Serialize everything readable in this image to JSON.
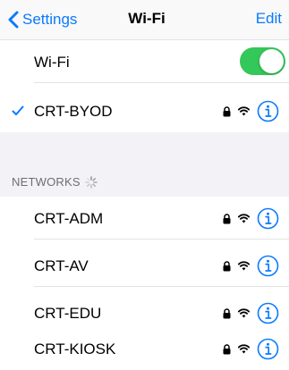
{
  "navbar": {
    "back_label": "Settings",
    "title": "Wi-Fi",
    "edit_label": "Edit"
  },
  "wifi_toggle": {
    "label": "Wi-Fi",
    "on": true
  },
  "connected": {
    "name": "CRT-BYOD",
    "secured": true
  },
  "networks_header": "NETWORKS",
  "networks": [
    {
      "name": "CRT-ADM",
      "secured": true
    },
    {
      "name": "CRT-AV",
      "secured": true
    },
    {
      "name": "CRT-EDU",
      "secured": true
    },
    {
      "name": "CRT-KIOSK",
      "secured": true
    }
  ],
  "icons": [
    "chevron-left-icon",
    "checkmark-icon",
    "lock-icon",
    "wifi-icon",
    "info-icon",
    "spinner-icon"
  ],
  "colors": {
    "accent": "#0a7aff",
    "toggle_on": "#34c759",
    "group_bg": "#f2f2f7"
  }
}
